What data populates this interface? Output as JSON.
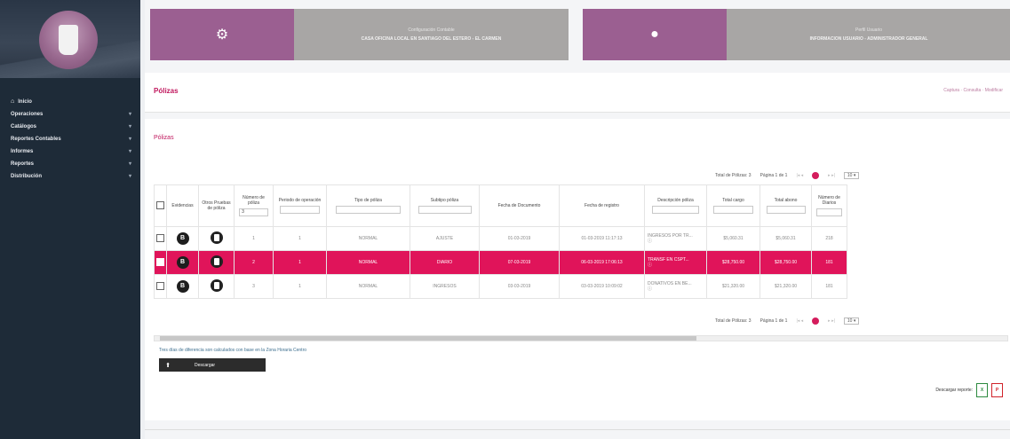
{
  "sidebar": {
    "items": [
      {
        "label": "Inicio",
        "chevron": false
      },
      {
        "label": "Operaciones",
        "chevron": true
      },
      {
        "label": "Catálogos",
        "chevron": true
      },
      {
        "label": "Reportes Contables",
        "chevron": true
      },
      {
        "label": "Informes",
        "chevron": true
      },
      {
        "label": "Reportes",
        "chevron": true
      },
      {
        "label": "Distribución",
        "chevron": true
      }
    ]
  },
  "cards": {
    "config": {
      "line1": "Configuración Contable",
      "line2": "CASA OFICINA LOCAL EN SANTIAGO DEL ESTERO - EL CARMEN",
      "icon": "gear-icon"
    },
    "user": {
      "line1": "Perfil Usuario",
      "line2": "INFORMACION USUARIO - ADMINISTRADOR GENERAL",
      "icon": "user-icon"
    }
  },
  "header": {
    "title": "Pólizas",
    "breadcrumb": "Captura · Consulta · Modificar"
  },
  "panel": {
    "title": "Pólizas"
  },
  "pager": {
    "total": "Total de Pólizas: 3",
    "page": "Página 1 de 1",
    "page_size": "10 ▾",
    "current": "1"
  },
  "table": {
    "headers": [
      "",
      "Evidencias",
      "Otros Pruebas de póliza",
      "Número de póliza",
      "Periodo de operación",
      "Tipo de póliza",
      "Subtipo póliza",
      "Fecha de Documento",
      "Fecha de registro",
      "Descripción póliza",
      "Total cargo",
      "Total abono",
      "Número de Diarios"
    ],
    "filter_values": [
      "",
      "",
      "",
      "3",
      "",
      "",
      "",
      "",
      "",
      "",
      "",
      "",
      ""
    ],
    "rows": [
      {
        "no": "1",
        "period": "1",
        "type": "NORMAL",
        "subtype": "AJUSTE",
        "doc": "01-03-2019",
        "reg": "01-03-2019 11:17:13",
        "desc": "INGRESOS POR TR...",
        "desc_icon": "ⓘ",
        "cargo": "$5,060.31",
        "abono": "$5,060.31",
        "diarios": "218",
        "selected": false
      },
      {
        "no": "2",
        "period": "1",
        "type": "NORMAL",
        "subtype": "DIARIO",
        "doc": "07-03-2019",
        "reg": "06-03-2019 17:06:13",
        "desc": "TRANSF EN CSPT...",
        "desc_icon": "ⓘ",
        "cargo": "$28,750.00",
        "abono": "$28,750.00",
        "diarios": "181",
        "selected": true
      },
      {
        "no": "3",
        "period": "1",
        "type": "NORMAL",
        "subtype": "INGRESOS",
        "doc": "03-03-2019",
        "reg": "03-03-2019 10:09:02",
        "desc": "DONATIVOS EN BE...",
        "desc_icon": "ⓘ",
        "cargo": "$21,320.00",
        "abono": "$21,320.00",
        "diarios": "181",
        "selected": false
      }
    ]
  },
  "note": "Tres días de diferencia son calculados con base en la Zona Horaria Centro",
  "download_button": "Descargar",
  "reports_label": "Descargar reporte:",
  "colors": {
    "brand": "#c0175d",
    "selected_row": "#e0145a",
    "card_purple": "#9b5f91",
    "sidebar": "#1e2b38"
  }
}
